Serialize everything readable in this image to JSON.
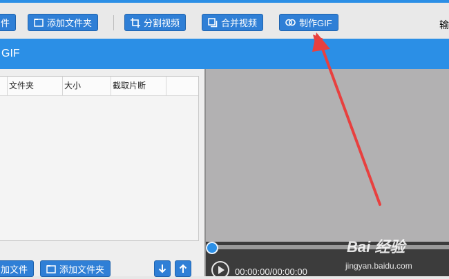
{
  "toolbar": {
    "add_file": "件",
    "add_folder": "添加文件夹",
    "split_video": "分割视频",
    "merge_video": "合并视频",
    "make_gif": "制作GIF",
    "right_text": "输"
  },
  "banner": {
    "title": "GIF"
  },
  "file_table": {
    "columns": [
      "文件夹",
      "大小",
      "截取片断"
    ]
  },
  "bottom_bar": {
    "add_file": "加文件",
    "add_folder": "添加文件夹"
  },
  "player": {
    "time": "00:00:00/00:00:00"
  },
  "watermark": {
    "line1": "Bai 经验",
    "line2": "jingyan.baidu.com"
  },
  "colors": {
    "accent": "#2b8fe6",
    "button": "#2f7fd6",
    "arrow": "#e8403f"
  }
}
